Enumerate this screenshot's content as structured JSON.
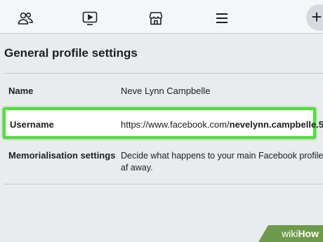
{
  "nav": {
    "icons": [
      "friends-icon",
      "watch-icon",
      "marketplace-icon",
      "menu-icon"
    ],
    "plus_label": "+"
  },
  "section_title": "General profile settings",
  "rows": {
    "name": {
      "label": "Name",
      "value": "Neve Lynn Campbelle"
    },
    "username": {
      "label": "Username",
      "url_prefix": "https://www.facebook.com/",
      "url_username": "nevelynn.campbelle.5"
    },
    "memorialisation": {
      "label": "Memorialisation settings",
      "description": "Decide what happens to your main Facebook profile af away."
    }
  },
  "watermark": {
    "wiki": "wiki",
    "how": "How"
  },
  "colors": {
    "highlight": "#4ee03a",
    "background": "#e9ebee",
    "watermark": "#6e9a4b"
  }
}
